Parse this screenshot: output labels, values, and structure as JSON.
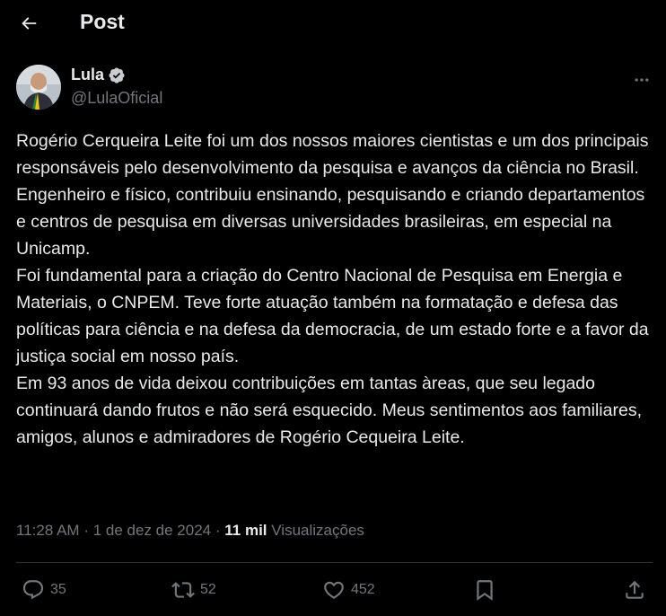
{
  "header": {
    "title": "Post",
    "back_icon": "arrow-left-icon"
  },
  "author": {
    "name": "Lula",
    "handle": "@LulaOficial",
    "verified_color": "#1d9bf0",
    "avatar_icon": "avatar"
  },
  "post": {
    "paragraphs": [
      "Rogério Cerqueira Leite foi um dos nossos maiores cientistas e um dos principais responsáveis pelo desenvolvimento da pesquisa e avanços da ciência no Brasil. Engenheiro e físico, contribuiu ensinando, pesquisando e criando departamentos e centros de pesquisa em diversas universidades brasileiras, em especial na Unicamp.",
      "Foi fundamental para a criação do Centro Nacional de Pesquisa em Energia e Materiais, o CNPEM. Teve forte atuação também na formatação e defesa das políticas para ciência e na defesa da democracia, de um estado forte e a favor da justiça social em nosso país.",
      "Em 93 anos de vida deixou contribuições em tantas àreas, que seu legado continuará dando frutos e não será esquecido. Meus sentimentos aos familiares, amigos, alunos e admiradores de Rogério Cequeira Leite."
    ]
  },
  "meta": {
    "time": "11:28 AM",
    "separator": "·",
    "date": "1 de dez de 2024",
    "views_count": "11 mil",
    "views_label": "Visualizações"
  },
  "actions": {
    "replies": "35",
    "reposts": "52",
    "likes": "452"
  },
  "colors": {
    "background": "#000000",
    "text": "#e7e9ea",
    "muted": "#71767b",
    "divider": "#2f3336",
    "accent": "#1d9bf0"
  }
}
